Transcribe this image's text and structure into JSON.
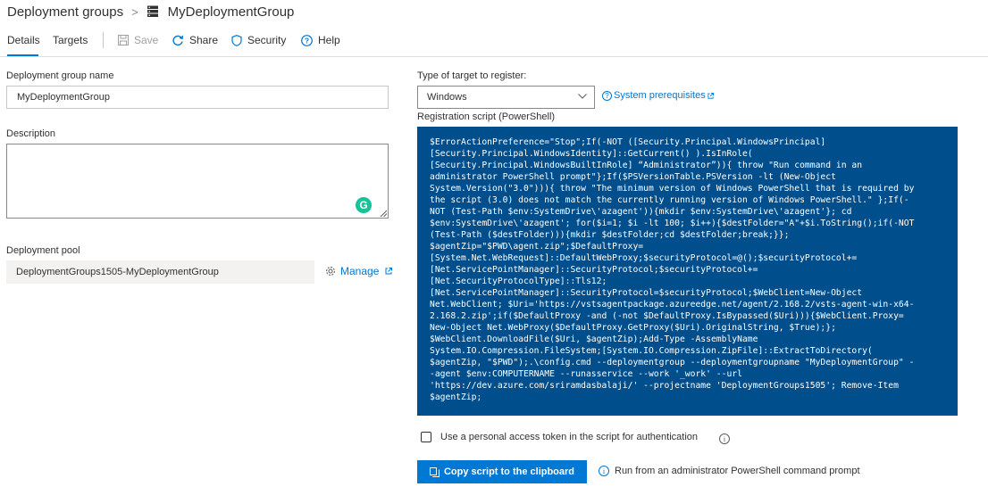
{
  "breadcrumb": {
    "root": "Deployment groups",
    "separator": ">",
    "current": "MyDeploymentGroup"
  },
  "toolbar": {
    "tabs": [
      {
        "label": "Details",
        "active": true
      },
      {
        "label": "Targets",
        "active": false
      }
    ],
    "save_label": "Save",
    "share_label": "Share",
    "security_label": "Security",
    "help_label": "Help"
  },
  "form": {
    "name_label": "Deployment group name",
    "name_value": "MyDeploymentGroup",
    "description_label": "Description",
    "description_value": "",
    "pool_label": "Deployment pool",
    "pool_value": "DeploymentGroups1505-MyDeploymentGroup",
    "manage_label": "Manage"
  },
  "target": {
    "type_label": "Type of target to register:",
    "selected": "Windows",
    "prereq_label": "System prerequisites",
    "script_label": "Registration script (PowerShell)",
    "script": "$ErrorActionPreference=\"Stop\";If(-NOT ([Security.Principal.WindowsPrincipal]\n[Security.Principal.WindowsIdentity]::GetCurrent() ).IsInRole(\n[Security.Principal.WindowsBuiltInRole] “Administrator”)){ throw \"Run command in an\nadministrator PowerShell prompt\"};If($PSVersionTable.PSVersion -lt (New-Object\nSystem.Version(\"3.0\"))){ throw \"The minimum version of Windows PowerShell that is required by\nthe script (3.0) does not match the currently running version of Windows PowerShell.\" };If(-\nNOT (Test-Path $env:SystemDrive\\'azagent')){mkdir $env:SystemDrive\\'azagent'}; cd\n$env:SystemDrive\\'azagent'; for($i=1; $i -lt 100; $i++){$destFolder=\"A\"+$i.ToString();if(-NOT\n(Test-Path ($destFolder))){mkdir $destFolder;cd $destFolder;break;}};\n$agentZip=\"$PWD\\agent.zip\";$DefaultProxy=\n[System.Net.WebRequest]::DefaultWebProxy;$securityProtocol=@();$securityProtocol+=\n[Net.ServicePointManager]::SecurityProtocol;$securityProtocol+=\n[Net.SecurityProtocolType]::Tls12;\n[Net.ServicePointManager]::SecurityProtocol=$securityProtocol;$WebClient=New-Object\nNet.WebClient; $Uri='https://vstsagentpackage.azureedge.net/agent/2.168.2/vsts-agent-win-x64-\n2.168.2.zip';if($DefaultProxy -and (-not $DefaultProxy.IsBypassed($Uri))){$WebClient.Proxy=\nNew-Object Net.WebProxy($DefaultProxy.GetProxy($Uri).OriginalString, $True);};\n$WebClient.DownloadFile($Uri, $agentZip);Add-Type -AssemblyName\nSystem.IO.Compression.FileSystem;[System.IO.Compression.ZipFile]::ExtractToDirectory(\n$agentZip, \"$PWD\");.\\config.cmd --deploymentgroup --deploymentgroupname \"MyDeploymentGroup\" -\n-agent $env:COMPUTERNAME --runasservice --work '_work' --url\n'https://dev.azure.com/sriramdasbalaji/' --projectname 'DeploymentGroups1505'; Remove-Item\n$agentZip;",
    "pat_label": "Use a personal access token in the script for authentication",
    "pat_checked": false,
    "copy_label": "Copy script to the clipboard",
    "run_note": "Run from an administrator PowerShell command prompt"
  },
  "colors": {
    "accent": "#0078d4",
    "script_bg": "#004e8c",
    "grammarly": "#15c39a"
  }
}
